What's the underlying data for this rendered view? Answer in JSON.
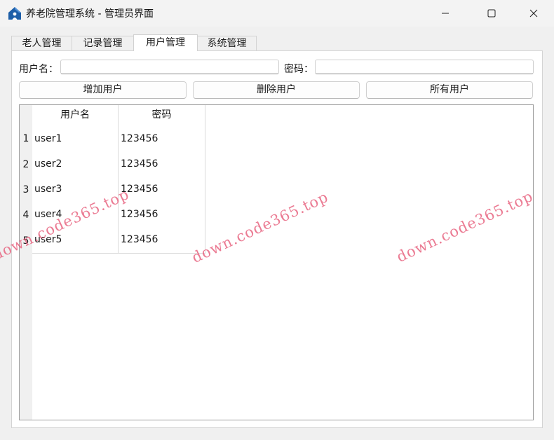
{
  "window": {
    "title": "养老院管理系统 - 管理员界面"
  },
  "tabs": [
    {
      "label": "老人管理"
    },
    {
      "label": "记录管理"
    },
    {
      "label": "用户管理",
      "active": true
    },
    {
      "label": "系统管理"
    }
  ],
  "form": {
    "username_label": "用户名：",
    "username_value": "",
    "password_label": "密码：",
    "password_value": ""
  },
  "actions": {
    "add_label": "增加用户",
    "delete_label": "删除用户",
    "all_label": "所有用户"
  },
  "table": {
    "columns": [
      "用户名",
      "密码"
    ],
    "rows": [
      {
        "num": "1",
        "username": "user1",
        "password": "123456"
      },
      {
        "num": "2",
        "username": "user2",
        "password": "123456"
      },
      {
        "num": "3",
        "username": "user3",
        "password": "123456"
      },
      {
        "num": "4",
        "username": "user4",
        "password": "123456"
      },
      {
        "num": "5",
        "username": "user5",
        "password": "123456"
      }
    ]
  },
  "watermark": "down.code365.top",
  "colors": {
    "app_icon": "#1e5fa8",
    "watermark": "#e65a78"
  }
}
